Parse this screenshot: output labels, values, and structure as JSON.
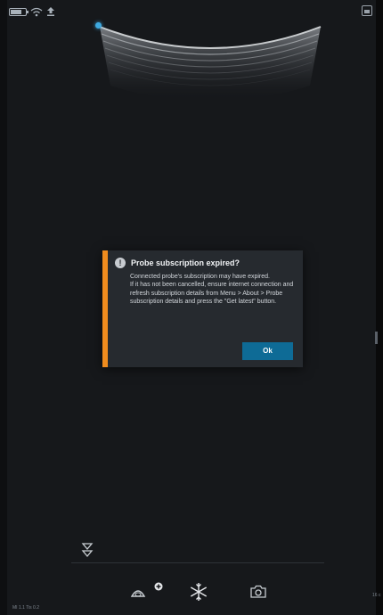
{
  "dialog": {
    "title": "Probe subscription expired?",
    "body_line_1": "Connected probe's subscription may have expired.",
    "body_line_2": "If it has not been cancelled, ensure internet connection and refresh subscription details from Menu > About > Probe subscription details and press the \"Get latest\" button.",
    "ok_label": "Ok",
    "accent_color": "#f08c1e",
    "button_color": "#0e6b96"
  },
  "status_bar": {
    "icons": [
      "battery-icon",
      "wifi-icon",
      "upload-icon"
    ]
  },
  "toolbar": {
    "icons": [
      "expand-controls-icon",
      "probe-add-icon",
      "freeze-icon",
      "camera-icon"
    ]
  },
  "footer": {
    "build_text": "MI 1.1 Tis 0.2",
    "depth_text": "16 c"
  }
}
